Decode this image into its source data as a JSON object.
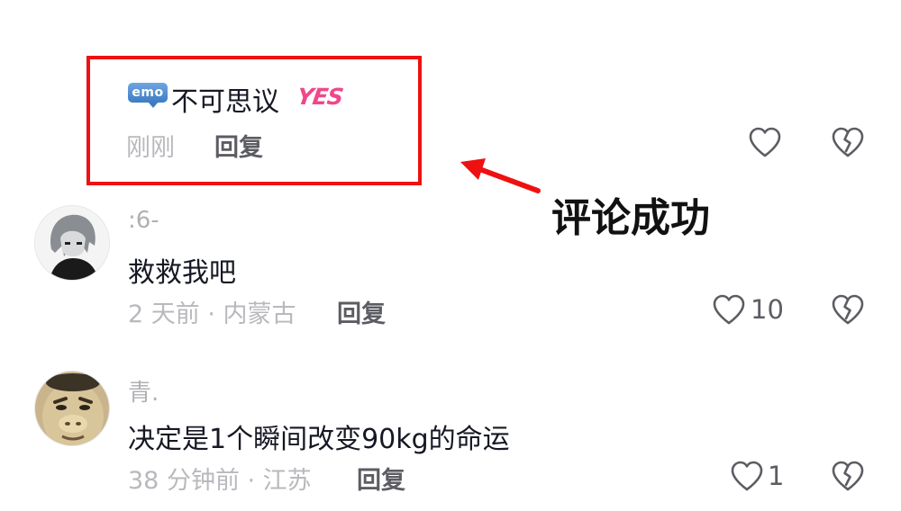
{
  "highlighted_comment": {
    "emoji_badge": "emo",
    "text": "不可思议",
    "sticker": "YES",
    "time": "刚刚",
    "reply_label": "回复",
    "icons": [
      "heart-outline-icon",
      "broken-heart-icon"
    ]
  },
  "annotation": {
    "label": "评论成功",
    "arrow_color": "#ee1111"
  },
  "comments": [
    {
      "username": ":6-",
      "text": "救救我吧",
      "meta": "2 天前 · 内蒙古",
      "reply_label": "回复",
      "like_count": "10",
      "avatar": "anime-character-avatar"
    },
    {
      "username": "青.",
      "text": "决定是1个瞬间改变90kg的命运",
      "meta": "38 分钟前 · 江苏",
      "reply_label": "回复",
      "like_count": "1",
      "avatar": "face-photo-avatar"
    }
  ],
  "colors": {
    "highlight_border": "#ee1111",
    "sticker": "#f0478a",
    "meta_gray": "#b8b9bd",
    "reply_gray": "#5c5d63"
  }
}
